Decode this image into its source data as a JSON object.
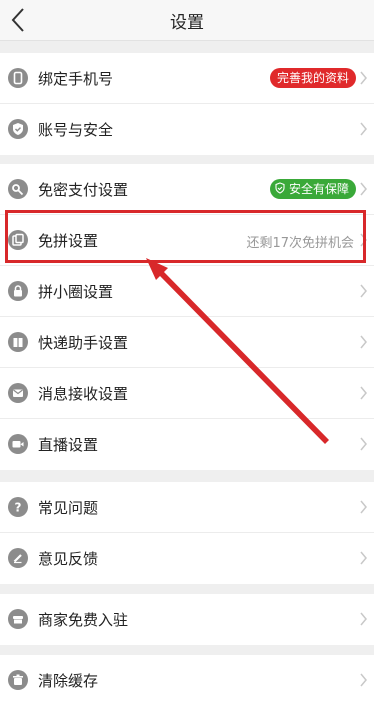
{
  "nav": {
    "title": "设置",
    "back_icon": "back-arrow-icon"
  },
  "groups": [
    {
      "items": [
        {
          "name": "bind-phone",
          "icon": "phone-icon",
          "label": "绑定手机号",
          "badge": "完善我的资料",
          "badge_color": "#e0292b"
        },
        {
          "name": "account-security",
          "icon": "shield-check-icon",
          "label": "账号与安全"
        }
      ]
    },
    {
      "items": [
        {
          "name": "password-free-pay",
          "icon": "key-icon",
          "label": "免密支付设置",
          "badge": "安全有保障",
          "badge_color": "#3aa939"
        },
        {
          "name": "free-group-buy",
          "icon": "coupon-icon",
          "label": "免拼设置",
          "hint": "还剩17次免拼机会"
        },
        {
          "name": "group-circle",
          "icon": "lock-icon",
          "label": "拼小圈设置"
        },
        {
          "name": "courier-assistant",
          "icon": "package-icon",
          "label": "快递助手设置"
        },
        {
          "name": "message-receive",
          "icon": "mail-icon",
          "label": "消息接收设置"
        },
        {
          "name": "live-stream",
          "icon": "video-camera-icon",
          "label": "直播设置"
        }
      ]
    },
    {
      "items": [
        {
          "name": "faq",
          "icon": "question-icon",
          "label": "常见问题"
        },
        {
          "name": "feedback",
          "icon": "pencil-icon",
          "label": "意见反馈"
        }
      ]
    },
    {
      "items": [
        {
          "name": "merchant-join",
          "icon": "store-icon",
          "label": "商家免费入驻"
        }
      ]
    },
    {
      "items": [
        {
          "name": "clear-cache",
          "icon": "trash-icon",
          "label": "清除缓存"
        }
      ]
    }
  ],
  "annotation": {
    "highlight_color": "#d8282a"
  }
}
